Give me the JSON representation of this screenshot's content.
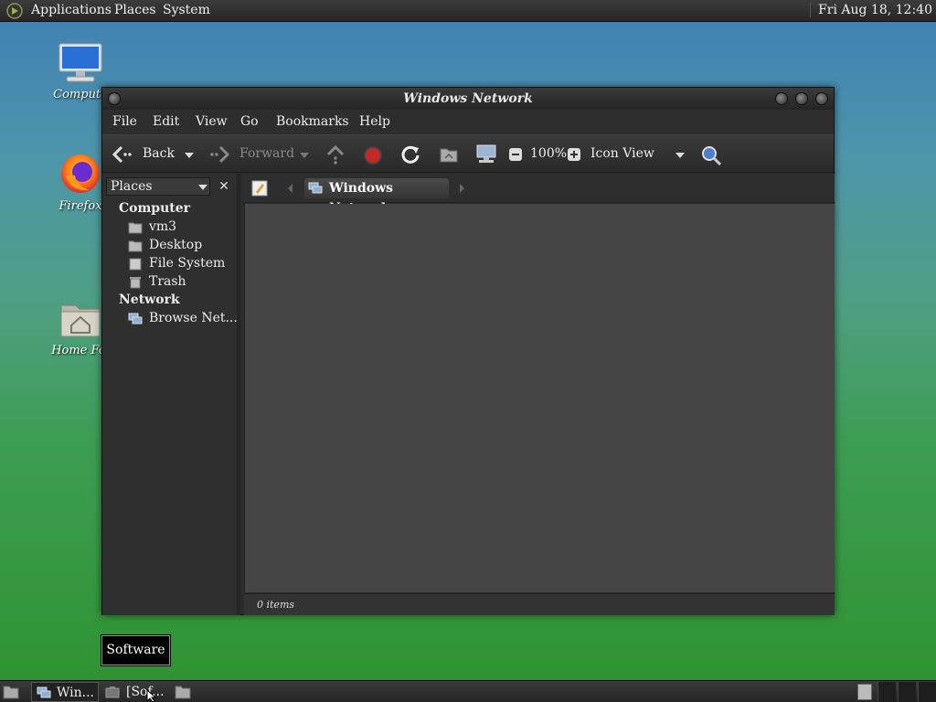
{
  "top_panel": {
    "menus": [
      "Applications",
      "Places",
      "System"
    ],
    "clock": "Fri Aug 18, 12:40"
  },
  "desktop_icons": [
    {
      "label": "Compute",
      "icon": "computer-icon"
    },
    {
      "label": "Firefox",
      "icon": "firefox-icon"
    },
    {
      "label": "Home Fol",
      "icon": "home-folder-icon"
    }
  ],
  "window": {
    "title": "Windows Network",
    "menubar": [
      "File",
      "Edit",
      "View",
      "Go",
      "Bookmarks",
      "Help"
    ],
    "toolbar": {
      "back": "Back",
      "forward": "Forward",
      "zoom": "100%",
      "view_mode": "Icon View"
    },
    "sidebar": {
      "selector": "Places",
      "close": "✕",
      "sections": [
        {
          "heading": "Computer",
          "items": [
            "vm3",
            "Desktop",
            "File System",
            "Trash"
          ]
        },
        {
          "heading": "Network",
          "items": [
            "Browse Net..."
          ]
        }
      ]
    },
    "location": {
      "crumb": "Windows Network"
    },
    "status": "0 items"
  },
  "tooltip": "Software",
  "taskbar": {
    "tasks": [
      "Win...",
      "[Sof..."
    ]
  },
  "colors": {
    "panel": "#262626",
    "content_bg": "#454545",
    "accent_stop": "#c62828"
  }
}
